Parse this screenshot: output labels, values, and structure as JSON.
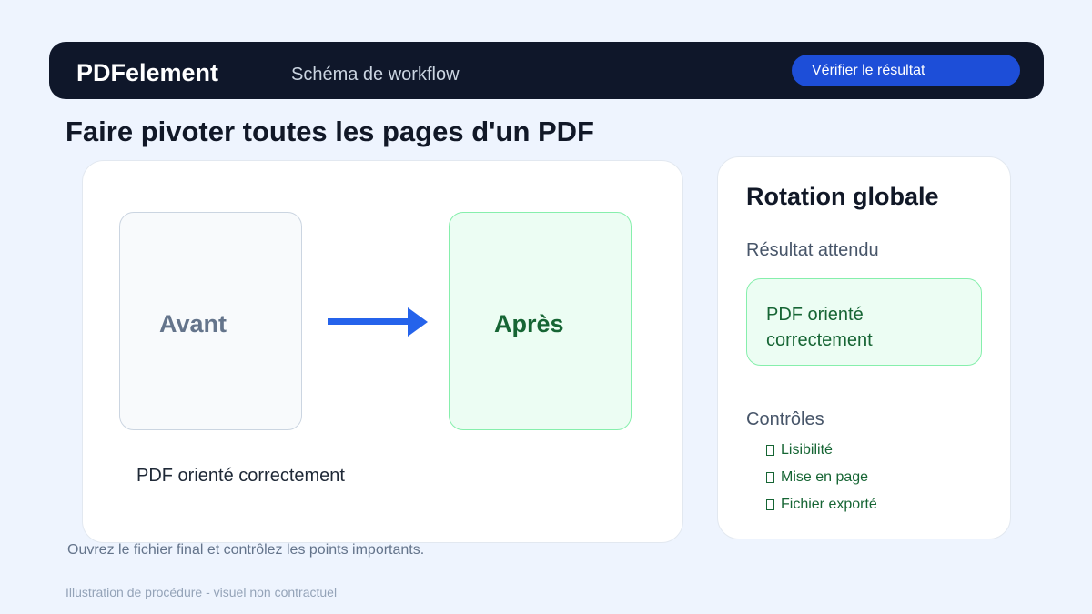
{
  "header": {
    "brand": "PDFelement",
    "workflow_label": "Schéma de workflow",
    "verify_button": "Vérifier le résultat"
  },
  "page": {
    "title": "Faire pivoter toutes les pages d'un PDF"
  },
  "diagram": {
    "before_label": "Avant",
    "after_label": "Après",
    "caption": "PDF orienté correctement"
  },
  "side": {
    "title": "Rotation globale",
    "expected_label": "Résultat attendu",
    "expected_result": "PDF orienté correctement",
    "checks_label": "Contrôles",
    "checks": [
      "Lisibilité",
      "Mise en page",
      "Fichier exporté"
    ]
  },
  "footer": {
    "note": "Ouvrez le fichier final et contrôlez les points importants.",
    "disclaimer": "Illustration de procédure - visuel non contractuel"
  },
  "colors": {
    "header_bg": "#0f172a",
    "accent_blue": "#1d4ed8",
    "arrow_blue": "#2563eb",
    "success_green": "#166534",
    "success_bg": "#ecfdf3"
  },
  "icons": {
    "arrow": "arrow-right-icon",
    "check": "checkbox-icon"
  }
}
